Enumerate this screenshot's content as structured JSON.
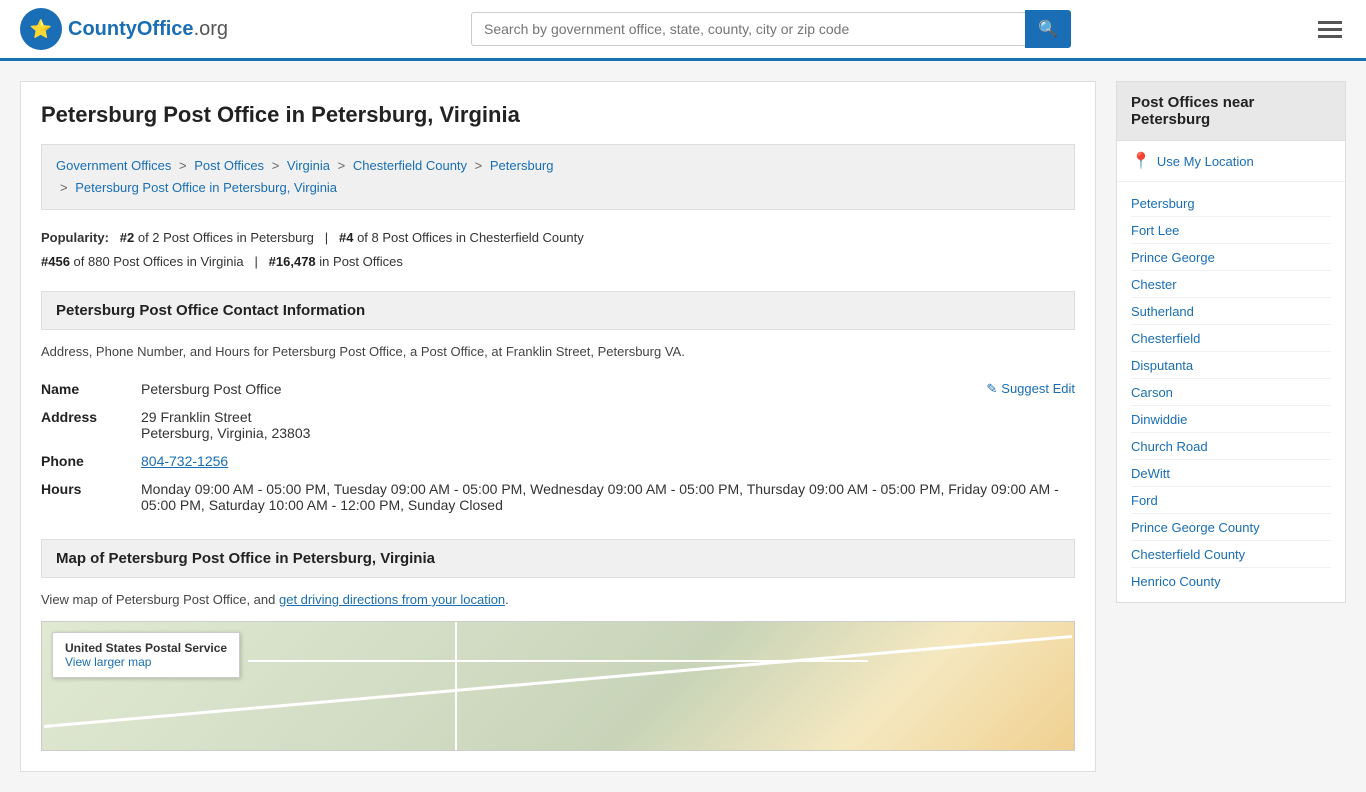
{
  "header": {
    "logo_text": "CountyOffice",
    "logo_org": ".org",
    "search_placeholder": "Search by government office, state, county, city or zip code",
    "search_icon": "🔍"
  },
  "page": {
    "title": "Petersburg Post Office in Petersburg, Virginia"
  },
  "breadcrumb": {
    "items": [
      {
        "label": "Government Offices",
        "href": "#"
      },
      {
        "label": "Post Offices",
        "href": "#"
      },
      {
        "label": "Virginia",
        "href": "#"
      },
      {
        "label": "Chesterfield County",
        "href": "#"
      },
      {
        "label": "Petersburg",
        "href": "#"
      },
      {
        "label": "Petersburg Post Office in Petersburg, Virginia",
        "href": "#"
      }
    ]
  },
  "popularity": {
    "label": "Popularity:",
    "rank1": "#2",
    "rank1_text": "of 2 Post Offices in Petersburg",
    "rank2": "#4",
    "rank2_text": "of 8 Post Offices in Chesterfield County",
    "rank3": "#456",
    "rank3_text": "of 880 Post Offices in Virginia",
    "rank4": "#16,478",
    "rank4_text": "in Post Offices"
  },
  "contact": {
    "section_title": "Petersburg Post Office Contact Information",
    "description": "Address, Phone Number, and Hours for Petersburg Post Office, a Post Office, at Franklin Street, Petersburg VA.",
    "suggest_edit_label": "Suggest Edit",
    "name_label": "Name",
    "name_value": "Petersburg Post Office",
    "address_label": "Address",
    "address_line1": "29 Franklin Street",
    "address_line2": "Petersburg, Virginia, 23803",
    "phone_label": "Phone",
    "phone_value": "804-732-1256",
    "hours_label": "Hours",
    "hours_value": "Monday 09:00 AM - 05:00 PM, Tuesday 09:00 AM - 05:00 PM, Wednesday 09:00 AM - 05:00 PM, Thursday 09:00 AM - 05:00 PM, Friday 09:00 AM - 05:00 PM, Saturday 10:00 AM - 12:00 PM, Sunday Closed"
  },
  "map_section": {
    "section_title": "Map of Petersburg Post Office in Petersburg, Virginia",
    "description": "View map of Petersburg Post Office, and",
    "link_text": "get driving directions from your location",
    "overlay_title": "United States Postal Service",
    "overlay_link": "View larger map"
  },
  "sidebar": {
    "title": "Post Offices near Petersburg",
    "use_location_label": "Use My Location",
    "items": [
      {
        "label": "Petersburg"
      },
      {
        "label": "Fort Lee"
      },
      {
        "label": "Prince George"
      },
      {
        "label": "Chester"
      },
      {
        "label": "Sutherland"
      },
      {
        "label": "Chesterfield"
      },
      {
        "label": "Disputanta"
      },
      {
        "label": "Carson"
      },
      {
        "label": "Dinwiddie"
      },
      {
        "label": "Church Road"
      },
      {
        "label": "DeWitt"
      },
      {
        "label": "Ford"
      },
      {
        "label": "Prince George County"
      },
      {
        "label": "Chesterfield County"
      },
      {
        "label": "Henrico County"
      }
    ]
  }
}
